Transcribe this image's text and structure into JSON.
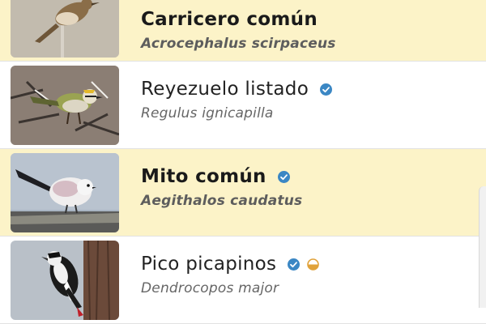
{
  "species": [
    {
      "common_name": "Carricero común",
      "scientific_name": "Acrocephalus scirpaceus",
      "highlighted": true,
      "badges": []
    },
    {
      "common_name": "Reyezuelo listado",
      "scientific_name": "Regulus ignicapilla",
      "highlighted": false,
      "badges": [
        "verified-check-icon"
      ]
    },
    {
      "common_name": "Mito común",
      "scientific_name": "Aegithalos caudatus",
      "highlighted": true,
      "badges": [
        "verified-check-icon"
      ]
    },
    {
      "common_name": "Pico picapinos",
      "scientific_name": "Dendrocopos major",
      "highlighted": false,
      "badges": [
        "verified-check-icon",
        "half-circle-status-icon"
      ]
    }
  ],
  "colors": {
    "highlight_bg": "#fcf3c8",
    "verified_badge": "#3b87c4",
    "status_badge": "#e0a23a"
  }
}
